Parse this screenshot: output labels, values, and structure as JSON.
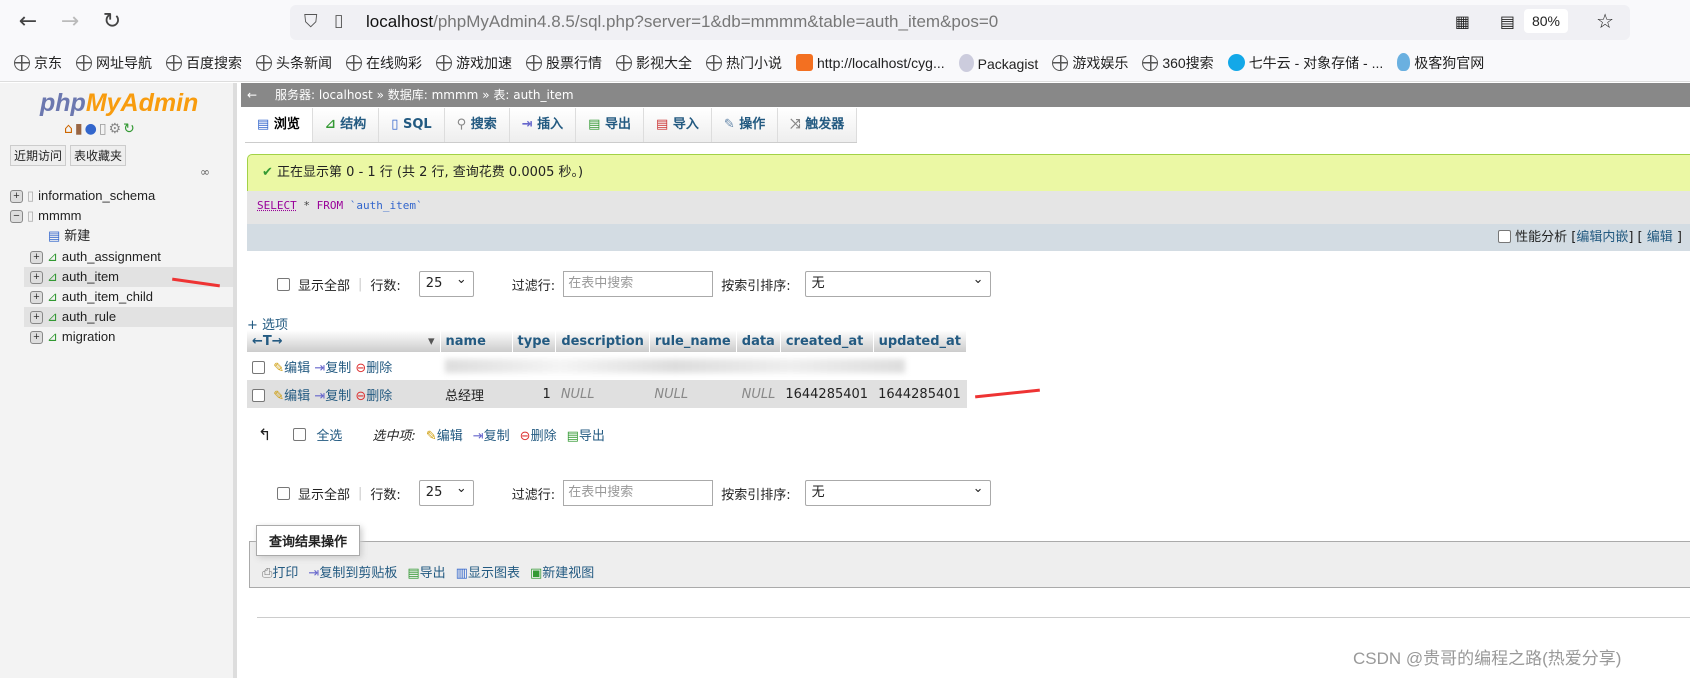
{
  "browser": {
    "url_host": "localhost",
    "url_rest": "/phpMyAdmin4.8.5/sql.php?server=1&db=mmmm&table=auth_item&pos=0",
    "zoom": "80%",
    "bookmarks": [
      "京东",
      "网址导航",
      "百度搜索",
      "头条新闻",
      "在线购彩",
      "游戏加速",
      "股票行情",
      "影视大全",
      "热门小说",
      "http://localhost/cyg...",
      "Packagist",
      "游戏娱乐",
      "360搜索",
      "七牛云 - 对象存储 - ...",
      "极客狗官网"
    ]
  },
  "sidebar": {
    "logo_php": "php",
    "logo_my": "MyAdmin",
    "recent": "近期访问",
    "favorites": "表收藏夹",
    "tree": [
      {
        "label": "information_schema",
        "sign": "+"
      },
      {
        "label": "mmmm",
        "sign": "−"
      }
    ],
    "children": [
      {
        "label": "新建"
      },
      {
        "label": "auth_assignment"
      },
      {
        "label": "auth_item"
      },
      {
        "label": "auth_item_child"
      },
      {
        "label": "auth_rule"
      },
      {
        "label": "migration"
      }
    ]
  },
  "breadcrumb": {
    "server": "服务器: localhost",
    "db": "数据库: mmmm",
    "table": "表: auth_item",
    "sep": "»"
  },
  "tabs": [
    "浏览",
    "结构",
    "SQL",
    "搜索",
    "插入",
    "导出",
    "导入",
    "操作",
    "触发器"
  ],
  "message": "正在显示第 0 - 1 行 (共 2 行, 查询花费 0.0005 秒。)",
  "sql": {
    "select": "SELECT",
    "star": " * ",
    "from": "FROM",
    "table": " `auth_item`"
  },
  "profiling": {
    "label": "性能分析",
    "inline": "编辑内嵌",
    "edit": "编辑"
  },
  "controls": {
    "show_all": "显示全部",
    "rows_label": "行数:",
    "rows_value": "25",
    "filter_label": "过滤行:",
    "filter_placeholder": "在表中搜索",
    "sort_label": "按索引排序:",
    "sort_value": "无"
  },
  "options_link": "+ 选项",
  "table": {
    "columns": [
      "name",
      "type",
      "description",
      "rule_name",
      "data",
      "created_at",
      "updated_at"
    ],
    "actions": {
      "edit": "编辑",
      "copy": "复制",
      "delete": "删除"
    },
    "rows": [
      {
        "name": "",
        "type": "",
        "description": "",
        "rule_name": "",
        "data": "",
        "created_at": "",
        "updated_at": "",
        "obscured": true
      },
      {
        "name": "总经理",
        "type": "1",
        "description": "NULL",
        "rule_name": "NULL",
        "data": "NULL",
        "created_at": "1644285401",
        "updated_at": "1644285401"
      }
    ]
  },
  "bulk": {
    "check_all": "全选",
    "with_selected": "选中项:",
    "edit": "编辑",
    "copy": "复制",
    "delete": "删除",
    "export": "导出"
  },
  "query_ops": {
    "legend": "查询结果操作",
    "items": [
      "打印",
      "复制到剪贴板",
      "导出",
      "显示图表",
      "新建视图"
    ]
  },
  "watermark": "CSDN @贵哥的编程之路(热爱分享)",
  "colors": {
    "link": "#235a81",
    "success_bg": "#ebf8a4",
    "arrow": "#e33333"
  }
}
